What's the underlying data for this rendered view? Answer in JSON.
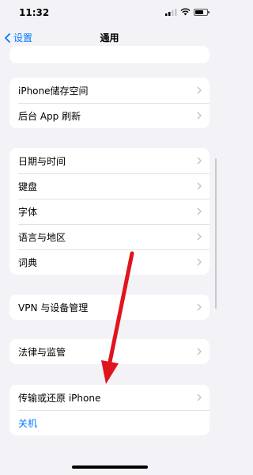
{
  "status_bar": {
    "time": "11:32",
    "battery_level": 0.7
  },
  "nav": {
    "back_label": "设置",
    "title": "通用"
  },
  "groups": [
    {
      "items": [
        {
          "label": "iPhone储存空间"
        },
        {
          "label": "后台 App 刷新"
        }
      ]
    },
    {
      "items": [
        {
          "label": "日期与时间"
        },
        {
          "label": "键盘"
        },
        {
          "label": "字体"
        },
        {
          "label": "语言与地区"
        },
        {
          "label": "词典"
        }
      ]
    },
    {
      "items": [
        {
          "label": "VPN 与设备管理"
        }
      ]
    },
    {
      "items": [
        {
          "label": "法律与监管"
        }
      ]
    },
    {
      "items": [
        {
          "label": "传输或还原 iPhone"
        },
        {
          "label": "关机"
        }
      ]
    }
  ],
  "colors": {
    "accent": "#007aff",
    "annotation_arrow": "#e0141d",
    "background": "#f2f2f7"
  },
  "icons": {
    "back": "chevron-left-icon",
    "row": "chevron-right-icon"
  }
}
